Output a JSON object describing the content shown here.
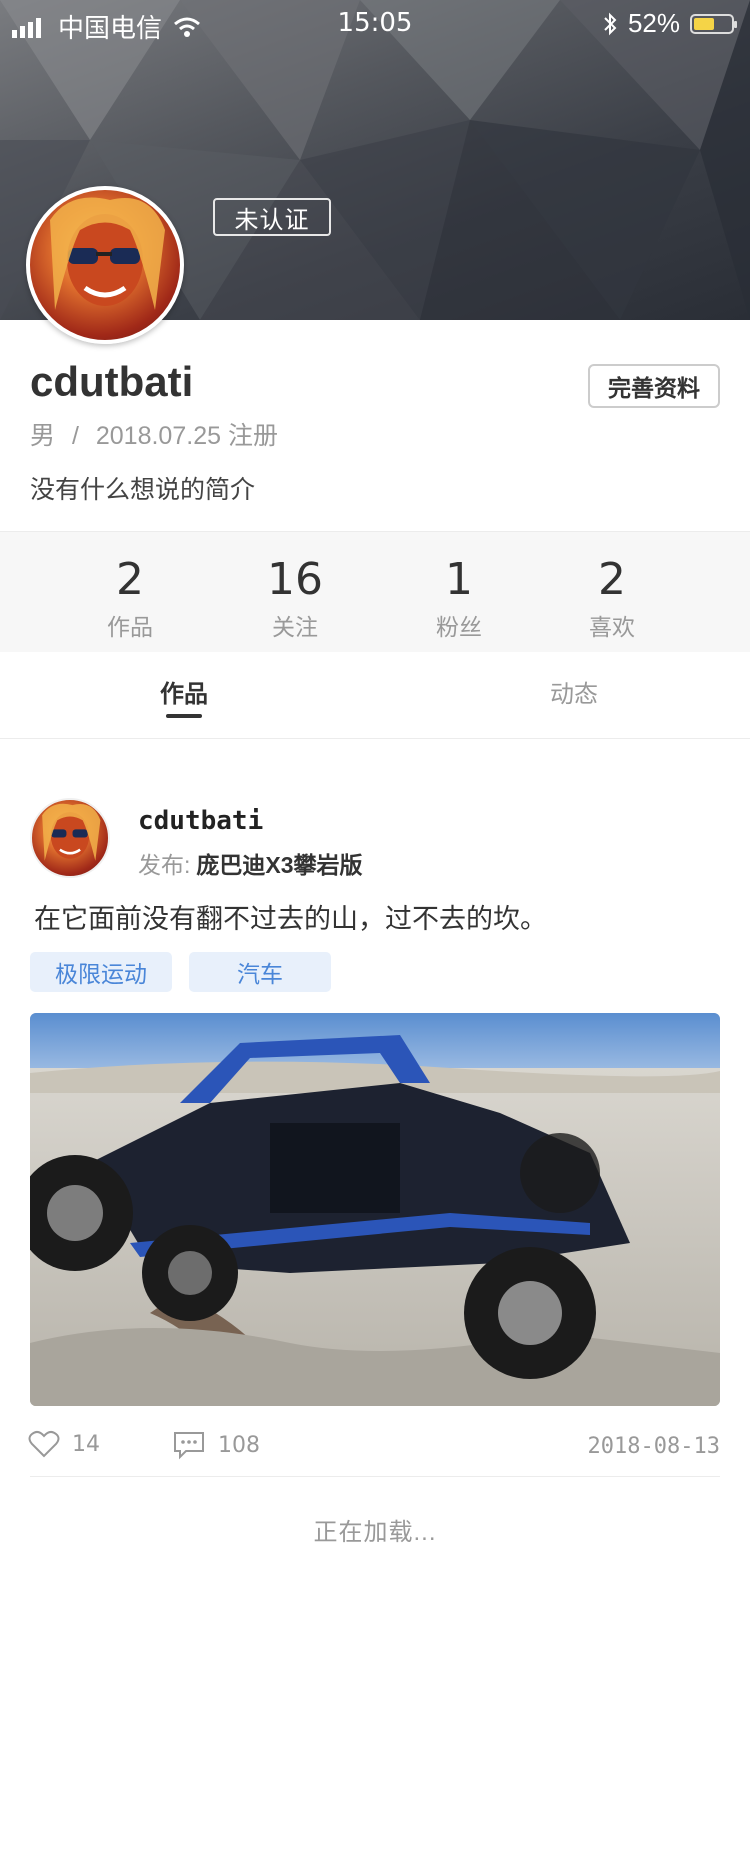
{
  "status_bar": {
    "carrier": "中国电信",
    "time": "15:05",
    "battery": "52%",
    "battery_level": 0.52
  },
  "profile": {
    "verification_badge": "未认证",
    "username": "cdutbati",
    "edit_button": "完善资料",
    "gender": "男",
    "separator": "/",
    "register_text": "2018.07.25 注册",
    "bio": "没有什么想说的简介"
  },
  "stats": [
    {
      "value": "2",
      "label": "作品"
    },
    {
      "value": "16",
      "label": "关注"
    },
    {
      "value": "1",
      "label": "粉丝"
    },
    {
      "value": "2",
      "label": "喜欢"
    }
  ],
  "tabs": [
    {
      "label": "作品",
      "active": true
    },
    {
      "label": "动态",
      "active": false
    }
  ],
  "post": {
    "username": "cdutbati",
    "publish_key": "发布:",
    "publish_value": "庞巴迪X3攀岩版",
    "text": "在它面前没有翻不过去的山，过不去的坎。",
    "tags": [
      "极限运动",
      "汽车"
    ],
    "likes": "14",
    "comments": "108",
    "date": "2018-08-13"
  },
  "loading_text": "正在加载...",
  "colors": {
    "tag_bg": "#e8f0fb",
    "tag_text": "#4a86d8",
    "battery_fill": "#f5d447",
    "primary_text": "#333333",
    "secondary_text": "#999999"
  },
  "icons": {
    "signal": "signal-bars-icon",
    "wifi": "wifi-icon",
    "bluetooth": "bluetooth-icon",
    "like": "heart-outline-icon",
    "comment": "chat-bubble-icon"
  }
}
